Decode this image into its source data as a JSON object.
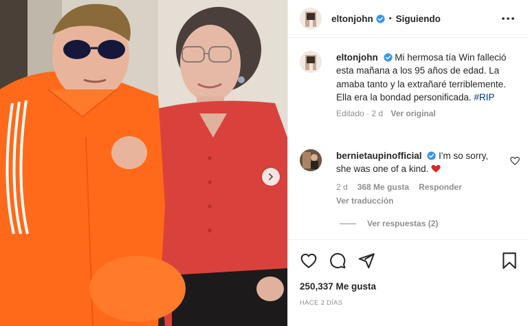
{
  "header": {
    "username": "eltonjohn",
    "separator": "•",
    "follow_status": "Siguiendo"
  },
  "caption": {
    "username": "eltonjohn",
    "text": "Mi hermosa tía Win falleció esta mañana a los 95 años de edad. La amaba tanto y la extrañaré terriblemente. Ella era la bondad personificada. ",
    "hashtag": "#RIP",
    "edited": "Editado · 2 d",
    "see_original": "Ver original"
  },
  "comment": {
    "username": "bernietaupinofficial",
    "text": "I'm so sorry, she was one of a kind.",
    "emoji": "heart-emoji",
    "age": "2 d",
    "likes": "368 Me gusta",
    "reply_label": "Responder",
    "translate_label": "Ver traducción"
  },
  "replies_label": "Ver respuestas (2)",
  "post": {
    "likes": "250,337 Me gusta",
    "date": "HACE 2 DÍAS"
  },
  "colors": {
    "verified": "#3897f0",
    "hashtag": "#00376b",
    "muted": "#8e8e8e",
    "text": "#262626",
    "heart": "#d62a2a"
  },
  "icons": [
    "verified-icon",
    "more-options-icon",
    "next-arrow-icon",
    "heart-icon",
    "comment-icon",
    "share-icon",
    "save-icon"
  ]
}
